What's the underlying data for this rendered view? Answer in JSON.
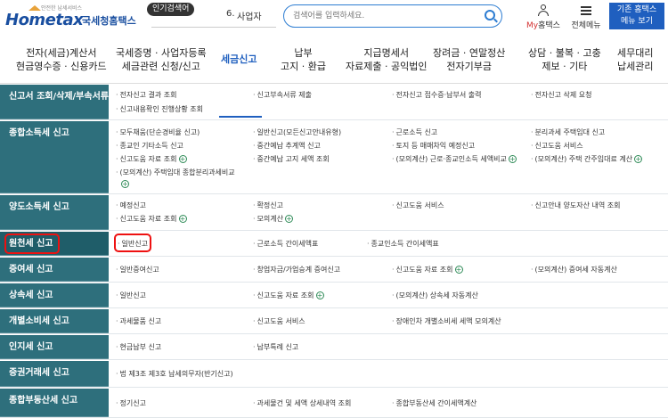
{
  "header": {
    "logo_tagline": "안전한 납세서비스",
    "logo_brand": "Hometax",
    "logo_brand_ko": "국세청홈택스",
    "popular_label": "인기검색어",
    "popular_rank": "6.",
    "popular_term": "사업자",
    "search_placeholder": "검색어를 입력하세요.",
    "my_hometax_my": "My",
    "my_hometax_rest": "홈택스",
    "full_menu_label": "전체메뉴",
    "legacy_line1": "기존 홈택스",
    "legacy_line2": "메뉴 보기"
  },
  "nav": [
    {
      "l1": "전자(세금)계산서",
      "l2": "현금영수증 · 신용카드"
    },
    {
      "l1": "국세증명 · 사업자등록",
      "l2": "세금관련 신청/신고"
    },
    {
      "l1": "세금신고",
      "l2": ""
    },
    {
      "l1": "납부",
      "l2": "고지 · 환급"
    },
    {
      "l1": "지급명세서",
      "l2": "자료제출 · 공익법인"
    },
    {
      "l1": "장려금 · 연말정산",
      "l2": "전자기부금"
    },
    {
      "l1": "상담 · 불복 · 고충",
      "l2": "제보 · 기타"
    },
    {
      "l1": "세무대리",
      "l2": "납세관리"
    }
  ],
  "rows": [
    {
      "head": "신고서 조회/삭제/부속서류",
      "items": [
        "전자신고 결과 조회",
        "신고부속서류 제출",
        "전자신고 접수증·납부서 출력",
        "전자신고 삭제 요청",
        "신고내용확인 진행상황 조회"
      ]
    },
    {
      "head": "종합소득세 신고",
      "items": [
        "모두채움(단순경비율 신고)",
        "일반신고(모든신고안내유형)",
        "근로소득 신고",
        "분리과세 주택임대 신고",
        "종교인 기타소득 신고",
        "중간예납 추계액 신고",
        "토지 등 매매차익 예정신고",
        "신고도움 서비스",
        "신고도움 자료 조회",
        "중간예납 고지 세액 조회",
        "(모의계산) 근로·종교인소득 세액비교",
        "(모의계산) 주택 간주임대료 계산",
        "(모의계산) 주택임대 종합분리과세비교"
      ]
    },
    {
      "head": "양도소득세 신고",
      "items": [
        "예정신고",
        "확정신고",
        "신고도움 서비스",
        "신고안내 양도자산 내역 조회",
        "신고도움 자료 조회",
        "모의계산"
      ]
    },
    {
      "head": "원천세 신고",
      "items": [
        "일반신고",
        "근로소득 간이세액표",
        "종교인소득 간이세액표"
      ]
    },
    {
      "head": "증여세 신고",
      "items": [
        "일반증여신고",
        "창업자금/가업승계 증여신고",
        "신고도움 자료 조회",
        "(모의계산) 증여세 자동계산"
      ]
    },
    {
      "head": "상속세 신고",
      "items": [
        "일반신고",
        "신고도움 자료 조회",
        "(모의계산) 상속세 자동계산"
      ]
    },
    {
      "head": "개별소비세 신고",
      "items": [
        "과세물품 신고",
        "신고도움 서비스",
        "장애인차 개별소비세 세액 모의계산"
      ]
    },
    {
      "head": "인지세 신고",
      "items": [
        "현금납부 신고",
        "납부특례 신고"
      ]
    },
    {
      "head": "증권거래세 신고",
      "items": [
        "법 제3조 제3호 납세의무자(반기신고)"
      ]
    },
    {
      "head": "종합부동산세 신고",
      "items": [
        "정기신고",
        "과세물건 및 세액 상세내역 조회",
        "종합부동산세 간이세액계산"
      ]
    }
  ]
}
